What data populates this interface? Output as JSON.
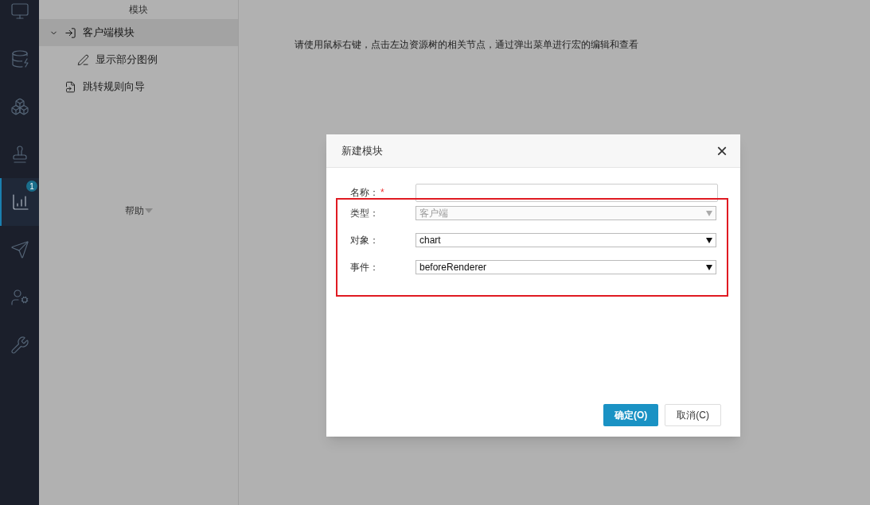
{
  "rail": [
    {
      "selected": false
    },
    {
      "selected": false
    },
    {
      "selected": false
    },
    {
      "selected": false
    },
    {
      "selected": true,
      "badge": "1"
    },
    {
      "selected": false
    },
    {
      "selected": false
    },
    {
      "selected": false
    }
  ],
  "sidebar": {
    "title": "模块",
    "tree": [
      {
        "label": "客户端模块",
        "expanded": true,
        "selected": true,
        "children": [
          {
            "label": "显示部分图例",
            "selected": false
          }
        ]
      },
      {
        "label": "跳转规则向导",
        "selected": false
      }
    ],
    "help": "帮助"
  },
  "main": {
    "hint": "请使用鼠标右键，点击左边资源树的相关节点，通过弹出菜单进行宏的编辑和查看"
  },
  "dialog": {
    "title": "新建模块",
    "close": "×",
    "fields": [
      {
        "kind": "input",
        "label": "名称：",
        "required_mark": "*"
      }
    ],
    "highlight_box": {
      "fields": [
        {
          "kind": "select",
          "label": "类型：",
          "value": "客户端",
          "disabled": true
        },
        {
          "kind": "select",
          "label": "对象：",
          "value": "chart",
          "disabled": false
        },
        {
          "kind": "select",
          "label": "事件：",
          "value": "beforeRenderer",
          "disabled": false
        }
      ]
    },
    "buttons": [
      {
        "label": "确定(O)",
        "primary": true
      },
      {
        "label": "取消(C)",
        "primary": false
      }
    ]
  }
}
